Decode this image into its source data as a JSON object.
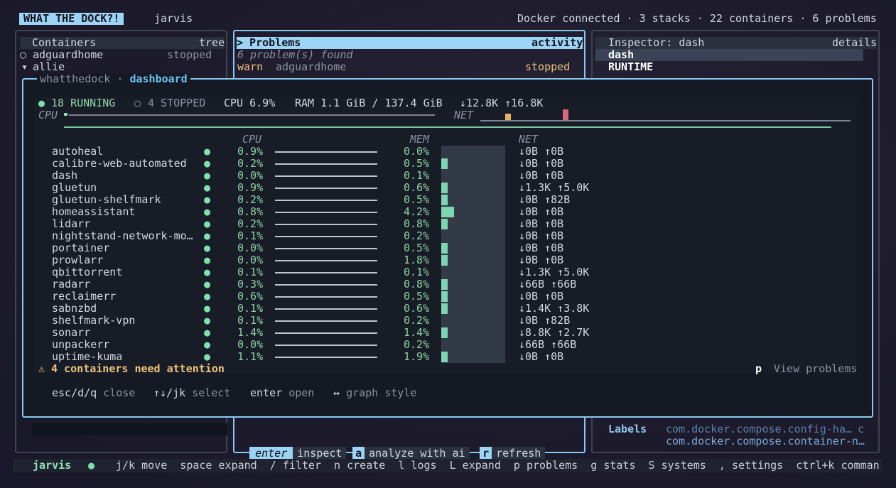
{
  "topbar": {
    "brand": "WHAT THE DOCK?!",
    "host": "jarvis",
    "status": "Docker connected · 3 stacks · 22 containers · 6 problems"
  },
  "containers_panel": {
    "title": "Containers",
    "mode": "tree",
    "items": [
      {
        "icon": "○",
        "name": "adguardhome",
        "status": "stopped"
      },
      {
        "icon": "▾",
        "name": "allie",
        "status": ""
      }
    ]
  },
  "problems_panel": {
    "title": "> Problems",
    "mode": "activity",
    "summary": "6 problem(s) found",
    "rows": [
      {
        "level": "warn",
        "name": "adguardhome",
        "status": "stopped"
      }
    ]
  },
  "inspector_panel": {
    "title": "Inspector: dash",
    "mode": "details",
    "selected": "dash",
    "section": "RUNTIME",
    "labels_key": "Labels",
    "labels_values": [
      "com.docker.compose.config-ha…",
      "com.docker.compose.container-n…"
    ],
    "labels_trail": "c"
  },
  "dashboard": {
    "title_prefix": "whatthedock ·",
    "title": "dashboard",
    "running": "18 RUNNING",
    "stopped": "4 STOPPED",
    "cpu": "CPU 6.9%",
    "ram": "RAM 1.1 GiB / 137.4 GiB",
    "net": "↓12.8K ↑16.8K",
    "cpu_label": "CPU",
    "net_label": "NET",
    "col_cpu": "CPU",
    "col_mem": "MEM",
    "col_net": "NET",
    "rows": [
      {
        "name": "autoheal",
        "cpu": "0.9%",
        "mem": "0.0%",
        "mem_frac": 0.0,
        "net": "↓0B ↑0B"
      },
      {
        "name": "calibre-web-automated",
        "cpu": "0.2%",
        "mem": "0.5%",
        "mem_frac": 0.1,
        "net": "↓0B ↑0B"
      },
      {
        "name": "dash",
        "cpu": "0.0%",
        "mem": "0.1%",
        "mem_frac": 0.0,
        "net": "↓0B ↑0B"
      },
      {
        "name": "gluetun",
        "cpu": "0.9%",
        "mem": "0.6%",
        "mem_frac": 0.1,
        "net": "↓1.3K ↑5.0K"
      },
      {
        "name": "gluetun-shelfmark",
        "cpu": "0.2%",
        "mem": "0.5%",
        "mem_frac": 0.1,
        "net": "↓0B ↑82B"
      },
      {
        "name": "homeassistant",
        "cpu": "0.8%",
        "mem": "4.2%",
        "mem_frac": 0.2,
        "net": "↓0B ↑0B"
      },
      {
        "name": "lidarr",
        "cpu": "0.2%",
        "mem": "0.8%",
        "mem_frac": 0.1,
        "net": "↓0B ↑0B"
      },
      {
        "name": "nightstand-network-mo…",
        "cpu": "0.1%",
        "mem": "0.2%",
        "mem_frac": 0.0,
        "net": "↓0B ↑0B"
      },
      {
        "name": "portainer",
        "cpu": "0.0%",
        "mem": "0.5%",
        "mem_frac": 0.1,
        "net": "↓0B ↑0B"
      },
      {
        "name": "prowlarr",
        "cpu": "0.0%",
        "mem": "1.8%",
        "mem_frac": 0.1,
        "net": "↓0B ↑0B"
      },
      {
        "name": "qbittorrent",
        "cpu": "0.1%",
        "mem": "0.1%",
        "mem_frac": 0.0,
        "net": "↓1.3K ↑5.0K"
      },
      {
        "name": "radarr",
        "cpu": "0.3%",
        "mem": "0.8%",
        "mem_frac": 0.1,
        "net": "↓66B ↑66B"
      },
      {
        "name": "reclaimerr",
        "cpu": "0.6%",
        "mem": "0.5%",
        "mem_frac": 0.1,
        "net": "↓0B ↑0B"
      },
      {
        "name": "sabnzbd",
        "cpu": "0.1%",
        "mem": "0.6%",
        "mem_frac": 0.1,
        "net": "↓1.4K ↑3.8K"
      },
      {
        "name": "shelfmark-vpn",
        "cpu": "0.1%",
        "mem": "0.2%",
        "mem_frac": 0.0,
        "net": "↓0B ↑82B"
      },
      {
        "name": "sonarr",
        "cpu": "1.4%",
        "mem": "1.4%",
        "mem_frac": 0.1,
        "net": "↓8.8K ↑2.7K"
      },
      {
        "name": "unpackerr",
        "cpu": "0.0%",
        "mem": "0.2%",
        "mem_frac": 0.0,
        "net": "↓66B ↑66B"
      },
      {
        "name": "uptime-kuma",
        "cpu": "1.1%",
        "mem": "1.9%",
        "mem_frac": 0.1,
        "net": "↓0B ↑0B"
      }
    ],
    "attention": "⚠ 4 containers need attention",
    "problems_key": "p",
    "problems_label": "View problems",
    "help": [
      {
        "key": "esc/d/q",
        "label": "close"
      },
      {
        "key": "↑↓/jk",
        "label": "select"
      },
      {
        "key": "enter",
        "label": "open"
      },
      {
        "key": "↔",
        "label": "graph style"
      }
    ]
  },
  "action_bar": [
    {
      "key": "enter",
      "label": "inspect"
    },
    {
      "key": "a",
      "label": "analyze with ai"
    },
    {
      "key": "r",
      "label": "refresh"
    }
  ],
  "footer": {
    "host": "jarvis",
    "dot": "●",
    "hints": "j/k move  space expand  / filter  n create  l logs  L expand  p problems  g stats  S systems  , settings  ctrl+k comman"
  },
  "colors": {
    "accent": "#86c8f2",
    "ok": "#7fe0ad",
    "warn": "#f0c27a",
    "mem_bar": "#7ed6b0",
    "net_spike_in": "#e3b463",
    "net_spike_out": "#e0677a"
  }
}
